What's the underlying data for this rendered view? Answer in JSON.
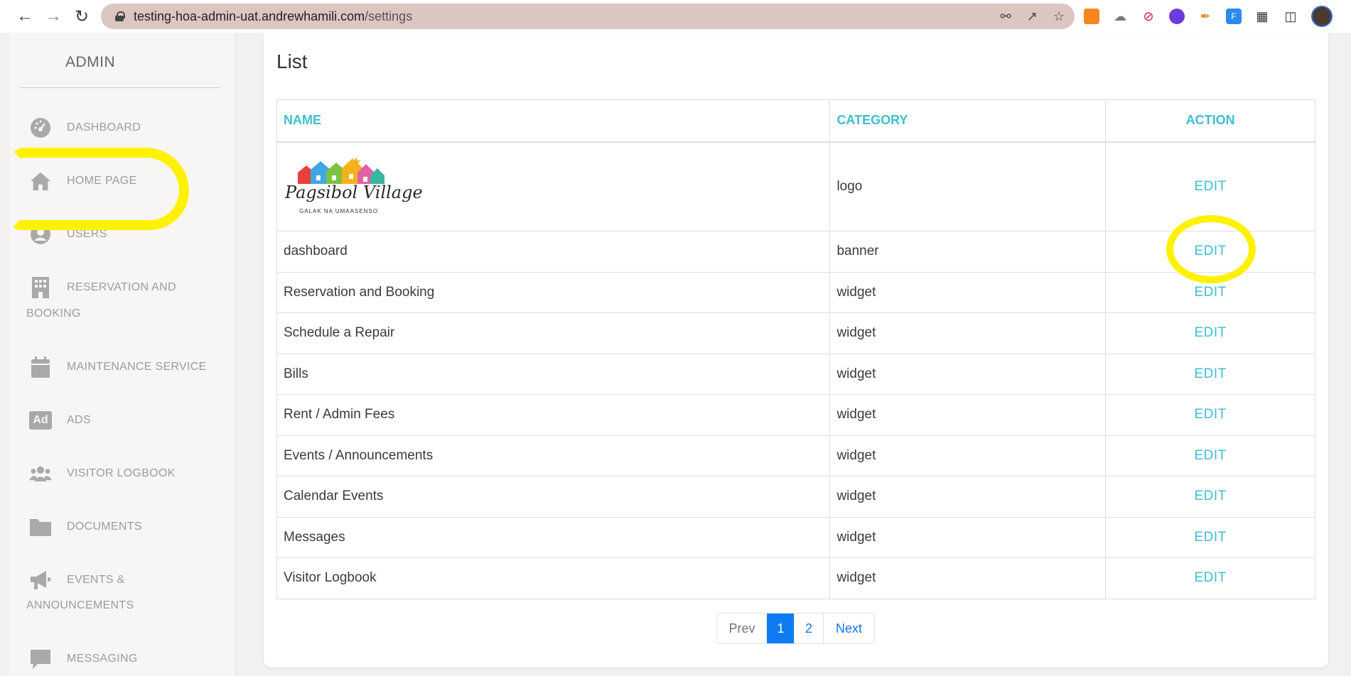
{
  "browser": {
    "url_host": "testing-hoa-admin-uat.andrewhamili.com",
    "url_path": "/settings",
    "back_icon": "arrow-left-icon",
    "forward_icon": "arrow-right-icon",
    "reload_icon": "reload-icon"
  },
  "sidebar": {
    "brand": "ADMIN",
    "items": [
      {
        "label": "DASHBOARD",
        "icon": "gauge-icon"
      },
      {
        "label": "HOME PAGE",
        "icon": "home-icon"
      },
      {
        "label": "USERS",
        "icon": "user-circle-icon"
      },
      {
        "label": "RESERVATION AND",
        "label2": "BOOKING",
        "icon": "building-icon"
      },
      {
        "label": "MAINTENANCE SERVICE",
        "icon": "calendar-icon"
      },
      {
        "label": "ADS",
        "icon": "ad-icon",
        "icon_text": "Ad"
      },
      {
        "label": "VISITOR LOGBOOK",
        "icon": "users-icon"
      },
      {
        "label": "DOCUMENTS",
        "icon": "folder-icon"
      },
      {
        "label": "EVENTS &",
        "label2": "ANNOUNCEMENTS",
        "icon": "megaphone-icon"
      },
      {
        "label": "MESSAGING",
        "icon": "chat-icon"
      }
    ]
  },
  "main": {
    "title": "List",
    "columns": [
      "NAME",
      "CATEGORY",
      "ACTION"
    ],
    "logo": {
      "script": "Pagsibol Village",
      "tagline": "GALAK NA UMAASENSO"
    },
    "rows": [
      {
        "name": "",
        "category": "logo",
        "action": "EDIT"
      },
      {
        "name": "dashboard",
        "category": "banner",
        "action": "EDIT"
      },
      {
        "name": "Reservation and Booking",
        "category": "widget",
        "action": "EDIT"
      },
      {
        "name": "Schedule a Repair",
        "category": "widget",
        "action": "EDIT"
      },
      {
        "name": "Bills",
        "category": "widget",
        "action": "EDIT"
      },
      {
        "name": "Rent / Admin Fees",
        "category": "widget",
        "action": "EDIT"
      },
      {
        "name": "Events / Announcements",
        "category": "widget",
        "action": "EDIT"
      },
      {
        "name": "Calendar Events",
        "category": "widget",
        "action": "EDIT"
      },
      {
        "name": "Messages",
        "category": "widget",
        "action": "EDIT"
      },
      {
        "name": "Visitor Logbook",
        "category": "widget",
        "action": "EDIT"
      }
    ],
    "pagination": {
      "prev": "Prev",
      "pages": [
        "1",
        "2"
      ],
      "current": "1",
      "next": "Next"
    }
  },
  "colors": {
    "accent": "#3fbfcf",
    "highlight": "#fff200",
    "active_page": "#0d7cf2"
  }
}
